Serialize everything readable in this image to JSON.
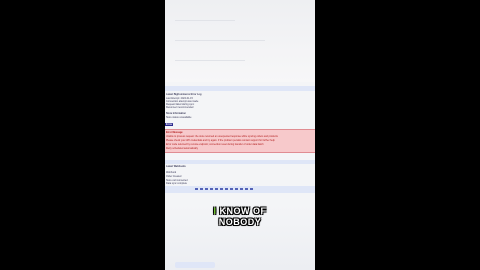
{
  "background_color": "#000000",
  "screen": {
    "upper_section": {
      "heading": "Latest BigCommerce Error Log",
      "lines": [
        "Last Attempt: 2024-01-15",
        "Connection attempt was made",
        "Request failed during sync",
        "Reconnect recommended"
      ],
      "section2_heading": "Store Information",
      "section2_lines": [
        "Store status unavailable"
      ]
    },
    "tab_label": "Error",
    "error_box": {
      "title": "Error Message",
      "lines": [
        "Unable to process request: the store returned an unexpected response while syncing orders and products",
        "Please check your API credentials and try again. If the problem persists contact support for further help",
        "Error code returned by remote endpoint; connection reset during transfer of order data batch",
        "Retry scheduled automatically"
      ]
    },
    "lower_section": {
      "heading": "Latest Webhooks",
      "lines": [
        "Webhook",
        "Order Created",
        "Store cart converted",
        "Data sync complete"
      ]
    },
    "toolbar_button_count": 12
  },
  "caption": {
    "highlight_word": "I",
    "line1_rest": "KNOW OF",
    "line2": "NOBODY",
    "highlight_color": "#7cd33a",
    "text_color": "#ffffff"
  }
}
